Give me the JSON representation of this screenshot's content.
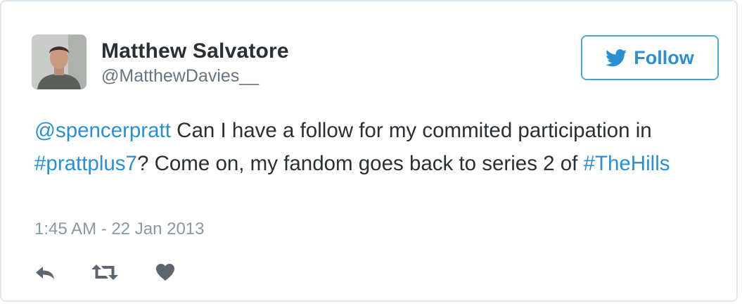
{
  "author": {
    "name": "Matthew Salvatore",
    "handle": "@MatthewDavies__"
  },
  "follow_button": {
    "label": "Follow",
    "icon": "twitter-bird-icon"
  },
  "tweet": {
    "mention": "@spencerpratt",
    "text_1": " Can I have a follow for my commited participation in ",
    "hashtag_1": "#prattplus7",
    "text_2": "? Come on, my fandom goes back to series 2 of ",
    "hashtag_2": "#TheHills",
    "timestamp": "1:45 AM - 22 Jan 2013"
  },
  "actions": [
    {
      "icon": "reply-icon"
    },
    {
      "icon": "retweet-icon"
    },
    {
      "icon": "like-icon"
    }
  ],
  "colors": {
    "link": "#2b8fd6",
    "text": "#292f33",
    "muted": "#8899a6",
    "border": "#e1e8ed",
    "icon": "#5b6670"
  }
}
